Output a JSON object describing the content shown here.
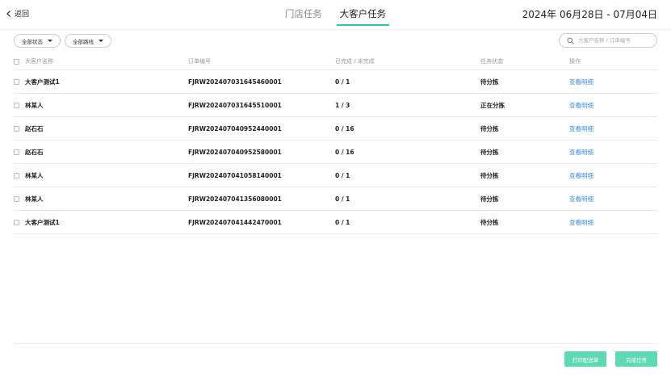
{
  "header": {
    "back_label": "返回",
    "tabs": [
      {
        "label": "门店任务",
        "active": false
      },
      {
        "label": "大客户任务",
        "active": true
      }
    ],
    "date_range": "2024年 06月28日 - 07月04日"
  },
  "filters": {
    "status_label": "全部状态",
    "route_label": "全部路线",
    "search_placeholder": "大客户名称 / 订单编号"
  },
  "table": {
    "columns": [
      "大客户名称",
      "订单编号",
      "已完成 / 未完成",
      "任务状态",
      "操作"
    ],
    "rows": [
      {
        "customer": "大客户测试1",
        "order_no": "FJRW202407031645460001",
        "progress": "0 / 1",
        "status": "待分拣",
        "action": "查看明细"
      },
      {
        "customer": "林某人",
        "order_no": "FJRW202407031645510001",
        "progress": "1 / 3",
        "status": "正在分拣",
        "action": "查看明细"
      },
      {
        "customer": "赵石石",
        "order_no": "FJRW202407040952440001",
        "progress": "0 / 16",
        "status": "待分拣",
        "action": "查看明细"
      },
      {
        "customer": "赵石石",
        "order_no": "FJRW202407040952580001",
        "progress": "0 / 16",
        "status": "待分拣",
        "action": "查看明细"
      },
      {
        "customer": "林某人",
        "order_no": "FJRW202407041058140001",
        "progress": "0 / 1",
        "status": "待分拣",
        "action": "查看明细"
      },
      {
        "customer": "林某人",
        "order_no": "FJRW202407041356080001",
        "progress": "0 / 1",
        "status": "待分拣",
        "action": "查看明细"
      },
      {
        "customer": "大客户测试1",
        "order_no": "FJRW202407041442470001",
        "progress": "0 / 1",
        "status": "待分拣",
        "action": "查看明细"
      }
    ]
  },
  "actions": {
    "print_label": "打印配送单",
    "complete_label": "完成任务"
  },
  "colors": {
    "accent": "#2fc6a4",
    "button": "#5fd9b4",
    "link": "#3a8ee6"
  }
}
